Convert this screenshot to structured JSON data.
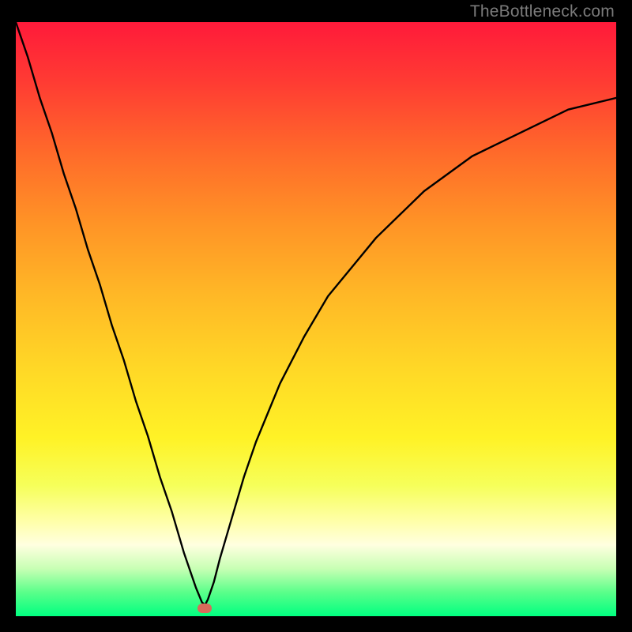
{
  "watermark": "TheBottleneck.com",
  "colors": {
    "page_bg": "#000000",
    "watermark": "#7b7b7b",
    "curve": "#000000",
    "marker": "#d96a5a",
    "gradient_top": "#ff1a3a",
    "gradient_bottom": "#00ff80"
  },
  "chart_data": {
    "type": "line",
    "title": "",
    "xlabel": "",
    "ylabel": "",
    "x": [
      0,
      0.02,
      0.04,
      0.06,
      0.08,
      0.1,
      0.12,
      0.14,
      0.16,
      0.18,
      0.2,
      0.22,
      0.24,
      0.26,
      0.28,
      0.3,
      0.31,
      0.315,
      0.32,
      0.33,
      0.34,
      0.36,
      0.38,
      0.4,
      0.44,
      0.48,
      0.52,
      0.56,
      0.6,
      0.64,
      0.68,
      0.72,
      0.76,
      0.8,
      0.84,
      0.88,
      0.92,
      0.96,
      1.0
    ],
    "values": [
      1.0,
      0.94,
      0.87,
      0.81,
      0.74,
      0.68,
      0.61,
      0.55,
      0.48,
      0.42,
      0.35,
      0.29,
      0.22,
      0.16,
      0.09,
      0.03,
      0.005,
      0.0,
      0.01,
      0.04,
      0.08,
      0.15,
      0.22,
      0.28,
      0.38,
      0.46,
      0.53,
      0.58,
      0.63,
      0.67,
      0.71,
      0.74,
      0.77,
      0.79,
      0.81,
      0.83,
      0.85,
      0.86,
      0.87
    ],
    "xlim": [
      0,
      1
    ],
    "ylim": [
      0,
      1
    ],
    "marker": {
      "x": 0.315,
      "y": 0.0
    },
    "notes": "V-shaped bottleneck curve; y=1 roughly corresponds to top of plot (red/high bottleneck), y=0 to bottom (green/optimal). Minimum at x≈0.315."
  }
}
